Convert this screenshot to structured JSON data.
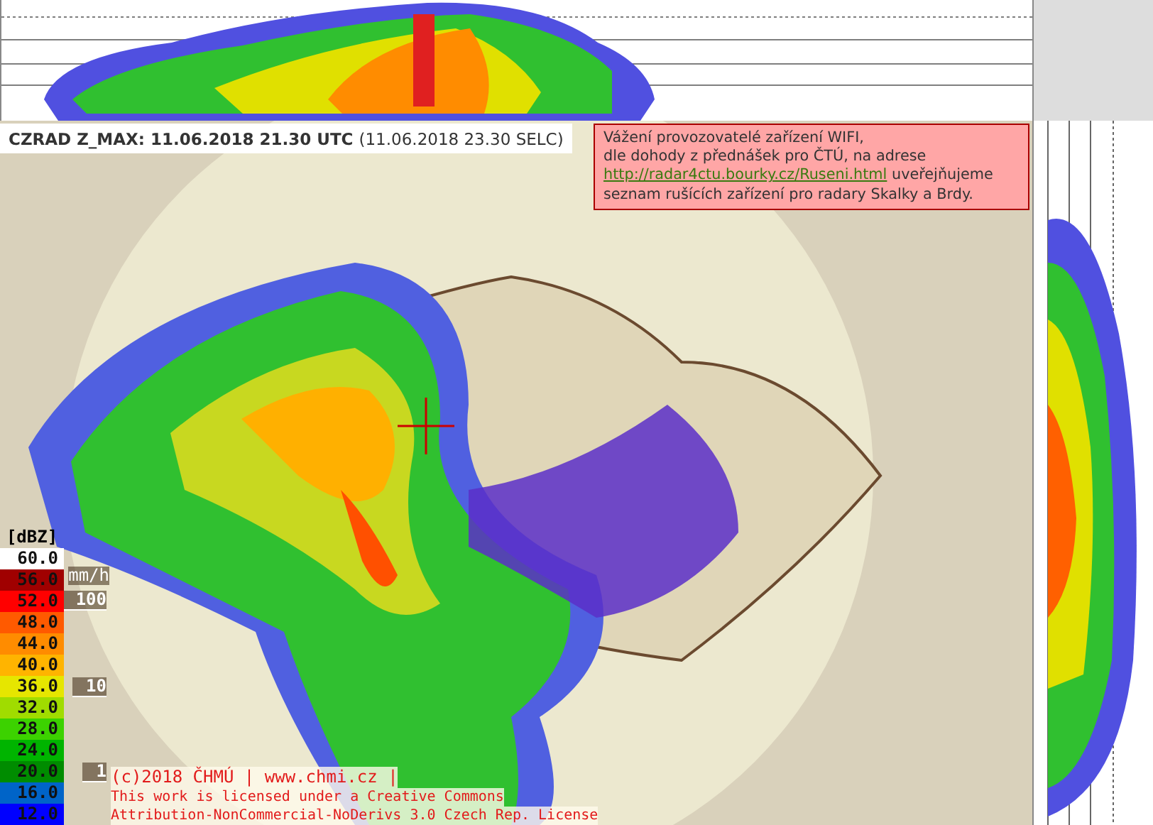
{
  "header": {
    "title": "CZRAD Z_MAX: 11.06.2018 21.30 UTC",
    "local_time": "(11.06.2018 23.30 SELC)"
  },
  "notice": {
    "before": "Vážení provozovatelé zařízení WIFI,\ndle dohody z přednášek pro ČTÚ, na adrese\n",
    "link": "http://radar4ctu.bourky.cz/Ruseni.html",
    "after": " uveřejňujeme\nseznam rušících zařízení pro radary Skalky a Brdy."
  },
  "legend": {
    "unit": "[dBZ]",
    "levels": [
      {
        "label": "60.0",
        "color": "#ffffff"
      },
      {
        "label": "56.0",
        "color": "#a00000"
      },
      {
        "label": "52.0",
        "color": "#ff0000"
      },
      {
        "label": "48.0",
        "color": "#ff5a00"
      },
      {
        "label": "44.0",
        "color": "#ff8c00"
      },
      {
        "label": "40.0",
        "color": "#ffb400"
      },
      {
        "label": "36.0",
        "color": "#e6e600"
      },
      {
        "label": "32.0",
        "color": "#a0dc00"
      },
      {
        "label": "28.0",
        "color": "#3cd200"
      },
      {
        "label": "24.0",
        "color": "#00b400"
      },
      {
        "label": "20.0",
        "color": "#008c00"
      },
      {
        "label": "16.0",
        "color": "#0064c8"
      },
      {
        "label": "12.0",
        "color": "#0000ff"
      }
    ]
  },
  "rain_scale": {
    "unit": "mm/h",
    "marks": [
      "100",
      "10",
      "1"
    ]
  },
  "credits": [
    "(c)2018 ČHMÚ | www.chmi.cz |",
    "This work is licensed under a Creative Commons",
    "Attribution-NonCommercial-NoDerivs 3.0 Czech Rep. License"
  ]
}
